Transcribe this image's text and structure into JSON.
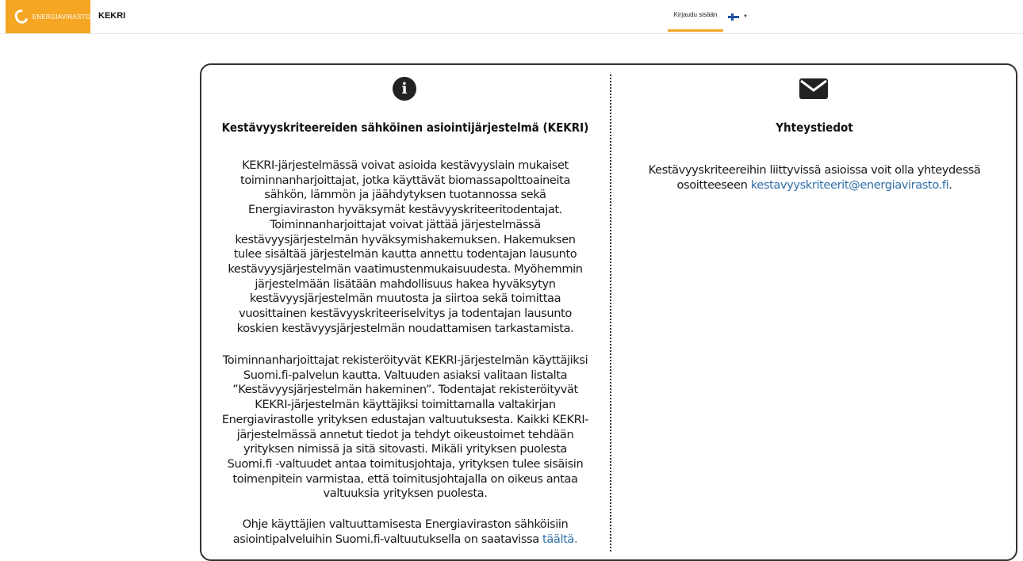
{
  "header": {
    "brand_text": "ENERGIAVIRASTO",
    "app_name": "KEKRI",
    "login_label": "Kirjaudu sisään",
    "language_flag": "finnish-flag-icon"
  },
  "info_panel": {
    "icon": "info-icon",
    "title": "Kestävyyskriteereiden sähköinen asiointijärjestelmä (KEKRI)",
    "paragraph1": "KEKRI-järjestelmässä voivat asioida kestävyyslain mukaiset toiminnanharjoittajat, jotka käyttävät biomassapolttoaineita sähkön, lämmön ja jäähdytyksen tuotannossa sekä Energiaviraston hyväksymät kestävyyskriteeritodentajat. Toiminnanharjoittajat voivat jättää järjestelmässä kestävyysjärjestelmän hyväksymishakemuksen. Hakemuksen tulee sisältää järjestelmän kautta annettu todentajan lausunto kestävyysjärjestelmän vaatimustenmukaisuudesta. Myöhemmin järjestelmään lisätään mahdollisuus hakea hyväksytyn kestävyysjärjestelmän muutosta ja siirtoa sekä toimittaa vuosittainen kestävyyskriteeriselvitys ja todentajan lausunto koskien kestävyysjärjestelmän noudattamisen tarkastamista.",
    "paragraph2": "Toiminnanharjoittajat rekisteröityvät KEKRI-järjestelmän käyttäjiksi Suomi.fi-palvelun kautta. Valtuuden asiaksi valitaan listalta ”Kestävyysjärjestelmän hakeminen”. Todentajat rekisteröityvät KEKRI-järjestelmän käyttäjiksi toimittamalla valtakirjan Energiavirastolle yrityksen edustajan valtuutuksesta. Kaikki KEKRI-järjestelmässä annetut tiedot ja tehdyt oikeustoimet tehdään yrityksen nimissä ja sitä sitovasti. Mikäli yrityksen puolesta Suomi.fi -valtuudet antaa toimitusjohtaja, yrityksen tulee sisäisin toimenpitein varmistaa, että toimitusjohtajalla on oikeus antaa valtuuksia yrityksen puolesta.",
    "paragraph3_text": "Ohje käyttäjien valtuuttamisesta Energiaviraston sähköisiin asiointipalveluihin Suomi.fi-valtuutuksella on saatavissa",
    "paragraph3_link": "täältä."
  },
  "contact_panel": {
    "icon": "envelope-icon",
    "title": "Yhteystiedot",
    "text": "Kestävyyskriteereihin liittyvissä asioissa voit olla yhteydessä osoitteeseen",
    "email": "kestavyyskriteerit@energiavirasto.fi",
    "trailing": "."
  },
  "colors": {
    "brand": "#f5a623",
    "link": "#2f6fa8",
    "border": "#333333"
  }
}
